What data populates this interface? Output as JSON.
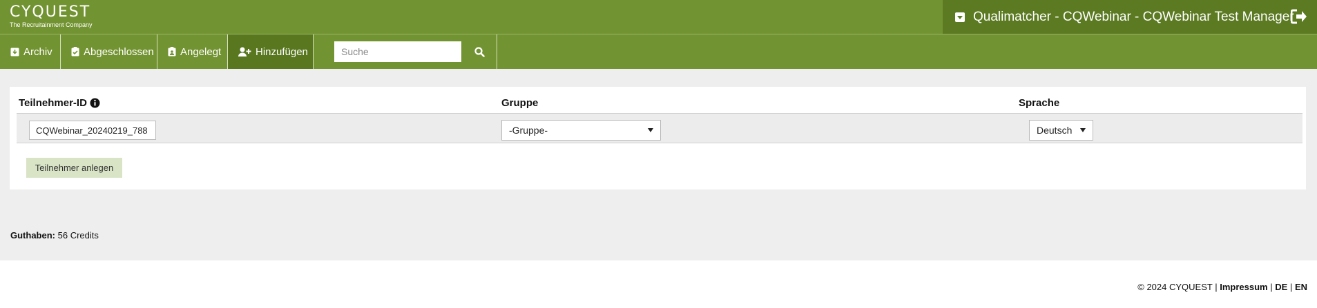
{
  "header": {
    "logo_brand": "CYQUEST",
    "logo_tagline": "The Recruitainment Company",
    "project_title": "Qualimatcher - CQWebinar - CQWebinar Test Manager"
  },
  "nav": {
    "items": [
      {
        "label": "Archiv",
        "icon": "archive-icon"
      },
      {
        "label": "Abgeschlossen",
        "icon": "clipboard-check-icon"
      },
      {
        "label": "Angelegt",
        "icon": "clipboard-user-icon"
      },
      {
        "label": "Hinzufügen",
        "icon": "user-plus-icon",
        "active": true
      }
    ],
    "search_placeholder": "Suche"
  },
  "form": {
    "headers": {
      "participant_id": "Teilnehmer-ID",
      "group": "Gruppe",
      "language": "Sprache"
    },
    "participant_id_value": "CQWebinar_20240219_788",
    "group_selected": "-Gruppe-",
    "language_selected": "Deutsch",
    "submit_label": "Teilnehmer anlegen"
  },
  "credits": {
    "label": "Guthaben:",
    "value": "56 Credits"
  },
  "footer": {
    "copyright": "© 2024 CYQUEST |",
    "impressum": "Impressum",
    "sep1": "|",
    "lang_de": "DE",
    "sep2": "|",
    "lang_en": "EN"
  },
  "colors": {
    "brand_green": "#729331",
    "dark_green": "#58771f",
    "button_green_light": "#d9e4c6"
  }
}
